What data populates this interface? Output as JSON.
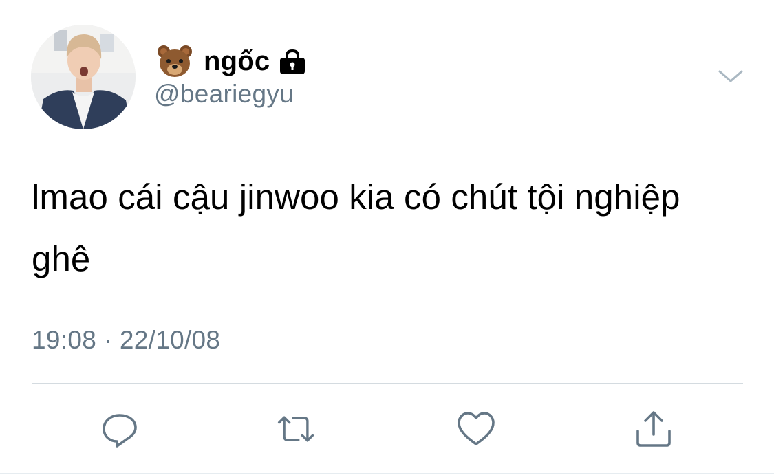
{
  "user": {
    "display_name": "ngốc",
    "handle": "@beariegyu",
    "name_emoji_icon": "bear-face-icon",
    "protected_icon": "lock-icon"
  },
  "tweet": {
    "text": "lmao cái cậu jinwoo kia có chút tội nghiệp ghê",
    "timestamp": "19:08 · 22/10/08"
  },
  "actions": {
    "reply_icon": "reply-icon",
    "retweet_icon": "retweet-icon",
    "like_icon": "heart-icon",
    "share_icon": "share-icon",
    "menu_icon": "chevron-down-icon"
  },
  "colors": {
    "secondary_text": "#657786",
    "action_icon": "#657786",
    "divider": "#d4dbe0"
  }
}
